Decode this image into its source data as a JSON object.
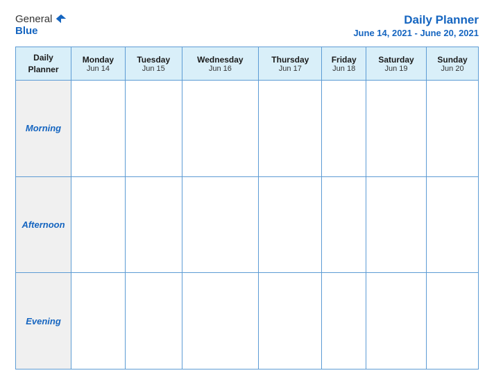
{
  "logo": {
    "general": "General",
    "blue": "Blue"
  },
  "title": {
    "main": "Daily Planner",
    "date_range": "June 14, 2021 - June 20, 2021"
  },
  "table": {
    "header_label_line1": "Daily",
    "header_label_line2": "Planner",
    "columns": [
      {
        "day": "Monday",
        "date": "Jun 14"
      },
      {
        "day": "Tuesday",
        "date": "Jun 15"
      },
      {
        "day": "Wednesday",
        "date": "Jun 16"
      },
      {
        "day": "Thursday",
        "date": "Jun 17"
      },
      {
        "day": "Friday",
        "date": "Jun 18"
      },
      {
        "day": "Saturday",
        "date": "Jun 19"
      },
      {
        "day": "Sunday",
        "date": "Jun 20"
      }
    ],
    "rows": [
      {
        "label": "Morning"
      },
      {
        "label": "Afternoon"
      },
      {
        "label": "Evening"
      }
    ]
  }
}
